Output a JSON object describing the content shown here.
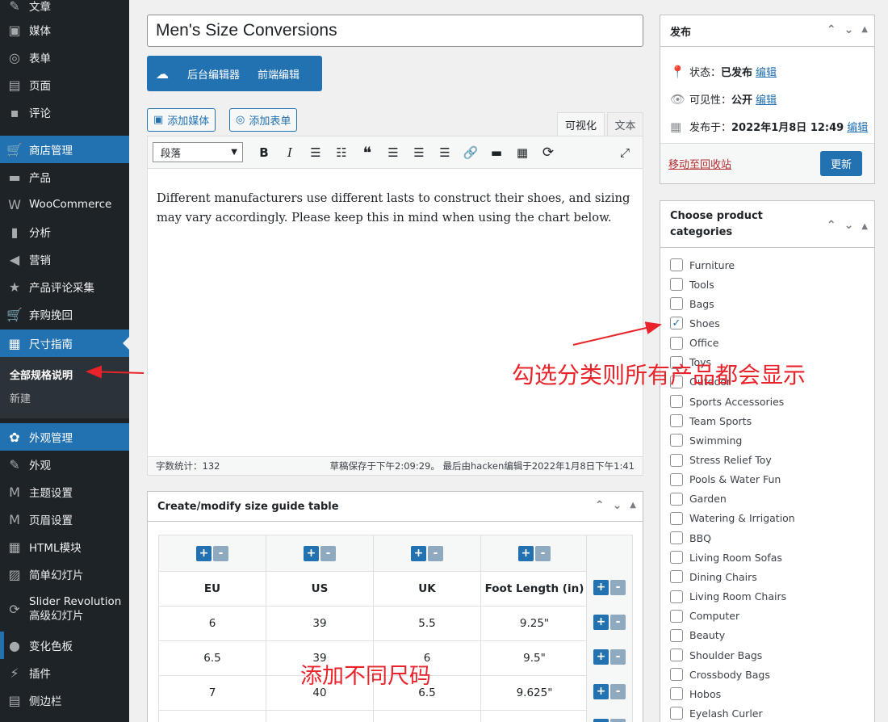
{
  "sidebar": {
    "items": [
      {
        "icon": "pin-icon",
        "glyph": "✎",
        "label": "文章"
      },
      {
        "icon": "media-icon",
        "glyph": "▣",
        "label": "媒体"
      },
      {
        "icon": "form-icon",
        "glyph": "◎",
        "label": "表单"
      },
      {
        "icon": "page-icon",
        "glyph": "▤",
        "label": "页面"
      },
      {
        "icon": "comment-icon",
        "glyph": "▪",
        "label": "评论"
      },
      {
        "icon": "cart-icon",
        "glyph": "🛒",
        "label": "商店管理"
      },
      {
        "icon": "archive-icon",
        "glyph": "▬",
        "label": "产品"
      },
      {
        "icon": "woo-icon",
        "glyph": "W",
        "label": "WooCommerce"
      },
      {
        "icon": "chart-icon",
        "glyph": "▮",
        "label": "分析"
      },
      {
        "icon": "megaphone-icon",
        "glyph": "◀",
        "label": "营销"
      },
      {
        "icon": "star-icon",
        "glyph": "★",
        "label": "产品评论采集"
      },
      {
        "icon": "cart-icon",
        "glyph": "🛒",
        "label": "弃购挽回"
      },
      {
        "icon": "table-icon",
        "glyph": "▦",
        "label": "尺寸指南"
      },
      {
        "icon": "palette-icon",
        "glyph": "✿",
        "label": "外观管理"
      },
      {
        "icon": "brush-icon",
        "glyph": "✎",
        "label": "外观"
      },
      {
        "icon": "m-icon",
        "glyph": "M",
        "label": "主题设置"
      },
      {
        "icon": "m-icon",
        "glyph": "M",
        "label": "页眉设置"
      },
      {
        "icon": "grid-icon",
        "glyph": "▦",
        "label": "HTML模块"
      },
      {
        "icon": "gallery-icon",
        "glyph": "▨",
        "label": "简单幻灯片"
      },
      {
        "icon": "refresh-icon",
        "glyph": "⟳",
        "label": "Slider Revolution",
        "label2": "高级幻灯片"
      },
      {
        "icon": "palette-icon",
        "glyph": "●",
        "label": "变化色板"
      },
      {
        "icon": "plugin-icon",
        "glyph": "⚡",
        "label": "插件"
      },
      {
        "icon": "sidebar-icon",
        "glyph": "▤",
        "label": "侧边栏"
      }
    ],
    "submenu": {
      "current": "全部规格说明",
      "new": "新建"
    }
  },
  "post": {
    "title": "Men's Size Conversions"
  },
  "builder": {
    "backend": "后台编辑器",
    "frontend": "前端编辑"
  },
  "media_buttons": {
    "add_media": "添加媒体",
    "add_form": "添加表单"
  },
  "tabs": {
    "visual": "可视化",
    "text": "文本"
  },
  "toolbar": {
    "format": "段落"
  },
  "content": {
    "text": "Different manufacturers use different lasts to construct their shoes, and sizing may vary accordingly. Please keep this in mind when using the chart below."
  },
  "status": {
    "word_count": "字数统计：132",
    "saved": "草稿保存于下午2:09:29。 最后由hacken编辑于2022年1月8日下午1:41"
  },
  "size_guide": {
    "title": "Create/modify size guide table",
    "headers": [
      "EU",
      "US",
      "UK",
      "Foot Length (in)"
    ],
    "rows": [
      [
        "6",
        "39",
        "5.5",
        "9.25\""
      ],
      [
        "6.5",
        "39",
        "6",
        "9.5\""
      ],
      [
        "7",
        "40",
        "6.5",
        "9.625\""
      ]
    ]
  },
  "publish": {
    "title": "发布",
    "status_label": "状态：",
    "status_value": "已发布",
    "visibility_label": "可见性：",
    "visibility_value": "公开",
    "published_label": "发布于：",
    "published_value": "2022年1月8日 12:49",
    "edit": "编辑",
    "trash": "移动至回收站",
    "update": "更新"
  },
  "categories": {
    "title_line1": "Choose product",
    "title_line2": "categories",
    "items": [
      {
        "label": "Furniture",
        "checked": false
      },
      {
        "label": "Tools",
        "checked": false
      },
      {
        "label": "Bags",
        "checked": false
      },
      {
        "label": "Shoes",
        "checked": true
      },
      {
        "label": "Office",
        "checked": false
      },
      {
        "label": "Toys",
        "checked": false
      },
      {
        "label": "Outdoor",
        "checked": false
      },
      {
        "label": "Sports Accessories",
        "checked": false
      },
      {
        "label": "Team Sports",
        "checked": false
      },
      {
        "label": "Swimming",
        "checked": false
      },
      {
        "label": "Stress Relief Toy",
        "checked": false
      },
      {
        "label": "Pools & Water Fun",
        "checked": false
      },
      {
        "label": "Garden",
        "checked": false
      },
      {
        "label": "Watering & Irrigation",
        "checked": false
      },
      {
        "label": "BBQ",
        "checked": false
      },
      {
        "label": "Living Room Sofas",
        "checked": false
      },
      {
        "label": "Dining Chairs",
        "checked": false
      },
      {
        "label": "Living Room Chairs",
        "checked": false
      },
      {
        "label": "Computer",
        "checked": false
      },
      {
        "label": "Beauty",
        "checked": false
      },
      {
        "label": "Shoulder Bags",
        "checked": false
      },
      {
        "label": "Crossbody Bags",
        "checked": false
      },
      {
        "label": "Hobos",
        "checked": false
      },
      {
        "label": "Eyelash Curler",
        "checked": false
      }
    ]
  },
  "annotations": {
    "categories_note": "勾选分类则所有产品都会显示",
    "sizes_note": "添加不同尺码"
  },
  "colors": {
    "accent": "#2271b1",
    "annotation": "#e8232a",
    "sidebar": "#1d2327"
  }
}
